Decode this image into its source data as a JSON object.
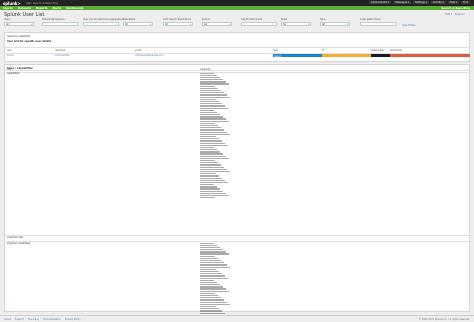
{
  "appbar": {
    "logo": "splunk>",
    "app_label": "App: Search & Reporting",
    "user_menus": [
      "Administrator ▾",
      "Messages ▾",
      "Settings ▾",
      "Activity ▾",
      "Help ▾",
      "Find"
    ]
  },
  "navbar": {
    "items": [
      "Search",
      "Datasets",
      "Reports",
      "Alerts",
      "Dashboards"
    ],
    "app_name": "Search & Reporting"
  },
  "page": {
    "title": "Splunk User List",
    "actions": [
      "Edit ▾",
      "Export ▾",
      "..."
    ]
  },
  "filters": {
    "fields": [
      {
        "label": "Users",
        "value": "All"
      },
      {
        "label": "Default Namespace",
        "value": ""
      },
      {
        "label": "User can be searched (aggregated)",
        "value": ""
      },
      {
        "label": "Real Name",
        "value": "All"
      },
      {
        "label": "Auth Search Restrictions",
        "value": "All"
      },
      {
        "label": "Source",
        "value": "All"
      },
      {
        "label": "Search Disk Quota",
        "value": ""
      },
      {
        "label": "Roles",
        "value": "All"
      },
      {
        "label": "Type",
        "value": "All"
      },
      {
        "label": "Index Restrictions",
        "value": ""
      }
    ],
    "hide_link": "Hide Filters"
  },
  "panels": {
    "owned_by": "Users by Capability",
    "user_list_title": "User List for specific user details",
    "capabilities_title": "Roles / Capabilities"
  },
  "user_table": {
    "headers": [
      "user",
      "realname",
      "email",
      "type",
      "tz",
      "default_app",
      "restrictions"
    ],
    "row": {
      "user": "admin",
      "realname": "Administrator",
      "email": "changeme@example.com",
      "type": "Splunk",
      "tz": "",
      "default_app": "",
      "restrictions": ""
    },
    "colors": {
      "type": "#1a83c6",
      "tz": "#f2b135",
      "default_app": "#1a1a1a",
      "restrictions": "#d85e3d"
    }
  },
  "capabilities": {
    "headers": [
      "role",
      "capability"
    ],
    "roles": [
      {
        "name": "capabilities",
        "lines": 58
      },
      {
        "name": "imported roles",
        "lines": 0
      },
      {
        "name": "imported capabilities",
        "lines": 36
      }
    ]
  },
  "footer": {
    "links": [
      "About",
      "Support",
      "File a Bug",
      "Documentation",
      "Privacy Policy"
    ],
    "copyright": "© 2005-2017 Splunk Inc. All rights reserved."
  }
}
